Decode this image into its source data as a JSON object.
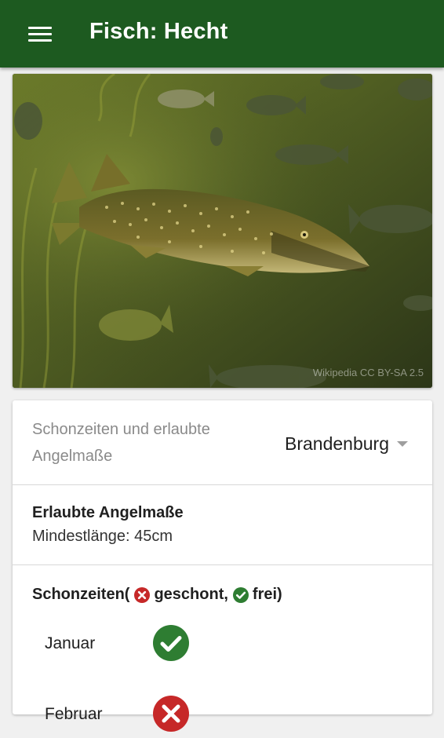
{
  "appbar": {
    "title": "Fisch: Hecht",
    "menu_icon": "hamburger-menu-icon"
  },
  "photo": {
    "credit": "Wikipedia CC BY-SA 2.5"
  },
  "regulations": {
    "label": "Schonzeiten und erlaubte Angelmaße",
    "region_selected": "Brandenburg",
    "sizes_title": "Erlaubte Angelmaße",
    "sizes_value": "Mindestlänge: 45cm",
    "closed_title_prefix": "Schonzeiten(",
    "closed_label": "geschont,",
    "free_label": "frei)",
    "months": [
      {
        "name": "Januar",
        "status": "frei"
      },
      {
        "name": "Februar",
        "status": "geschont"
      }
    ]
  },
  "colors": {
    "appbar": "#1d5a20",
    "free_green": "#2e7d32",
    "closed_red": "#c62828"
  }
}
